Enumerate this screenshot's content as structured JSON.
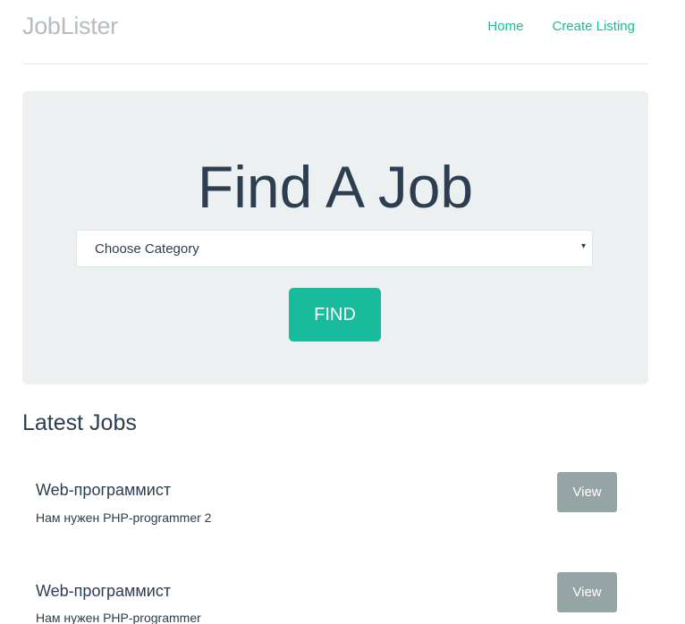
{
  "header": {
    "brand": "JobLister",
    "nav": [
      {
        "label": "Home"
      },
      {
        "label": "Create Listing"
      }
    ]
  },
  "jumbotron": {
    "title": "Find A Job",
    "category_select": {
      "selected": "Choose Category",
      "arrow": "▾"
    },
    "find_button": "FIND"
  },
  "latest": {
    "title": "Latest Jobs",
    "jobs": [
      {
        "title": "Web-программист",
        "description": "Нам нужен PHP-programmer 2",
        "view_label": "View"
      },
      {
        "title": "Web-программист",
        "description": "Нам нужен PHP-programmer",
        "view_label": "View"
      }
    ]
  },
  "colors": {
    "accent": "#18bc9c",
    "primary_text": "#2c3e50",
    "muted_brand": "#b4bcc2",
    "jumbotron_bg": "#ecf0f1",
    "view_button": "#95a5a6"
  }
}
